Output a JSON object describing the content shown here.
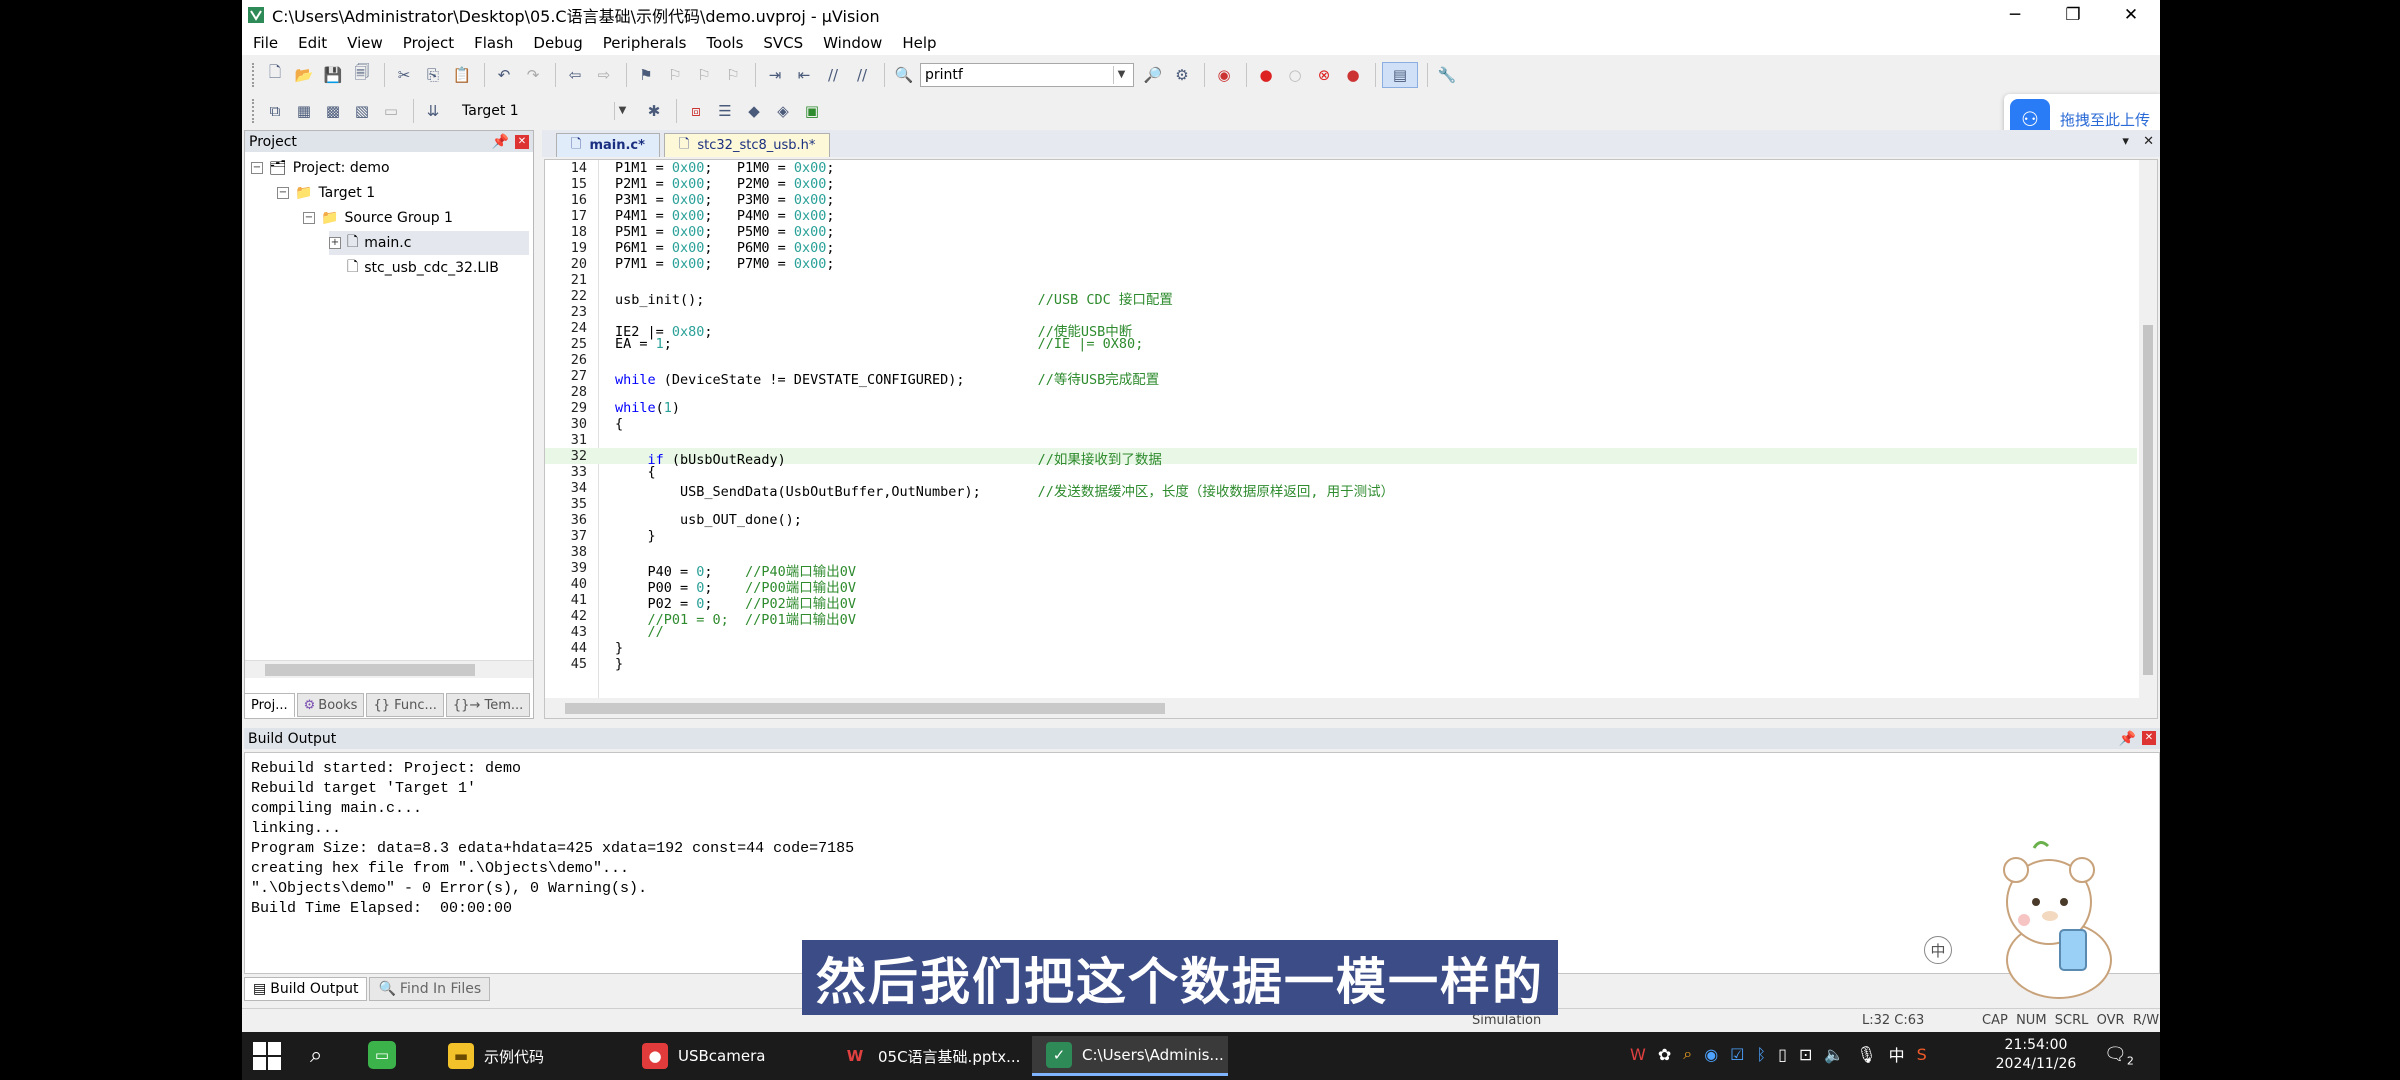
{
  "window": {
    "title": "C:\\Users\\Administrator\\Desktop\\05.C语言基础\\示例代码\\demo.uvproj - µVision"
  },
  "menu": [
    "File",
    "Edit",
    "View",
    "Project",
    "Flash",
    "Debug",
    "Peripherals",
    "Tools",
    "SVCS",
    "Window",
    "Help"
  ],
  "toolbar": {
    "find_combo_value": "printf",
    "target_combo_value": "Target 1"
  },
  "upload_button": {
    "label": "拖拽至此上传"
  },
  "project_panel": {
    "title": "Project",
    "tree": [
      {
        "label": "Project: demo"
      },
      {
        "label": "Target 1"
      },
      {
        "label": "Source Group 1"
      },
      {
        "label": "main.c"
      },
      {
        "label": "stc_usb_cdc_32.LIB"
      }
    ],
    "tabs": [
      "Proj...",
      "Books",
      "{} Func...",
      "{}→ Tem..."
    ]
  },
  "editor": {
    "tabs": [
      {
        "label": "main.c*",
        "active": true
      },
      {
        "label": "stc32_stc8_usb.h*",
        "active": false
      }
    ],
    "lines": [
      {
        "n": "14",
        "code": "P1M1 = 0x00;   P1M0 = 0x00;"
      },
      {
        "n": "15",
        "code": "P2M1 = 0x00;   P2M0 = 0x00;"
      },
      {
        "n": "16",
        "code": "P3M1 = 0x00;   P3M0 = 0x00;"
      },
      {
        "n": "17",
        "code": "P4M1 = 0x00;   P4M0 = 0x00;"
      },
      {
        "n": "18",
        "code": "P5M1 = 0x00;   P5M0 = 0x00;"
      },
      {
        "n": "19",
        "code": "P6M1 = 0x00;   P6M0 = 0x00;"
      },
      {
        "n": "20",
        "code": "P7M1 = 0x00;   P7M0 = 0x00;"
      },
      {
        "n": "21",
        "code": ""
      },
      {
        "n": "22",
        "code": "usb_init();                                         //USB CDC 接口配置"
      },
      {
        "n": "23",
        "code": ""
      },
      {
        "n": "24",
        "code": "IE2 |= 0x80;                                        //使能USB中断"
      },
      {
        "n": "25",
        "code": "EA = 1;                                             //IE |= 0X80;"
      },
      {
        "n": "26",
        "code": ""
      },
      {
        "n": "27",
        "code": "while (DeviceState != DEVSTATE_CONFIGURED);         //等待USB完成配置"
      },
      {
        "n": "28",
        "code": ""
      },
      {
        "n": "29",
        "code": "while(1)"
      },
      {
        "n": "30",
        "code": "{"
      },
      {
        "n": "31",
        "code": ""
      },
      {
        "n": "32",
        "code": "    if (bUsbOutReady)                               //如果接收到了数据"
      },
      {
        "n": "33",
        "code": "    {"
      },
      {
        "n": "34",
        "code": "        USB_SendData(UsbOutBuffer,OutNumber);       //发送数据缓冲区，长度（接收数据原样返回, 用于测试）"
      },
      {
        "n": "35",
        "code": ""
      },
      {
        "n": "36",
        "code": "        usb_OUT_done();"
      },
      {
        "n": "37",
        "code": "    }"
      },
      {
        "n": "38",
        "code": ""
      },
      {
        "n": "39",
        "code": "    P40 = 0;    //P40端口输出0V"
      },
      {
        "n": "40",
        "code": "    P00 = 0;    //P00端口输出0V"
      },
      {
        "n": "41",
        "code": "    P02 = 0;    //P02端口输出0V"
      },
      {
        "n": "42",
        "code": "    //P01 = 0;  //P01端口输出0V"
      },
      {
        "n": "43",
        "code": "    //"
      },
      {
        "n": "44",
        "code": "}"
      },
      {
        "n": "45",
        "code": "}"
      }
    ]
  },
  "build_output": {
    "title": "Build Output",
    "text": "Rebuild started: Project: demo\nRebuild target 'Target 1'\ncompiling main.c...\nlinking...\nProgram Size: data=8.3 edata+hdata=425 xdata=192 const=44 code=7185\ncreating hex file from \".\\Objects\\demo\"...\n\".\\Objects\\demo\" - 0 Error(s), 0 Warning(s).\nBuild Time Elapsed:  00:00:00",
    "tabs": [
      "Build Output",
      "Find In Files"
    ]
  },
  "status_bar": {
    "mode": "Simulation",
    "cursor": "L:32 C:63",
    "flags": "CAP  NUM  SCRL  OVR  R/W"
  },
  "subtitle": "然后我们把这个数据一模一样的",
  "mascot_badge": "中",
  "taskbar": {
    "apps": [
      {
        "label": "示例代码",
        "color": "#f3c22b"
      },
      {
        "label": "USBcamera",
        "color": "#e23b3b"
      },
      {
        "label": "05C语言基础.pptx...",
        "color": "#c0392b"
      },
      {
        "label": "C:\\Users\\Adminis...",
        "color": "#2e8b57"
      }
    ],
    "ime": "中",
    "time": "21:54:00",
    "date": "2024/11/26",
    "notifications": "2"
  }
}
